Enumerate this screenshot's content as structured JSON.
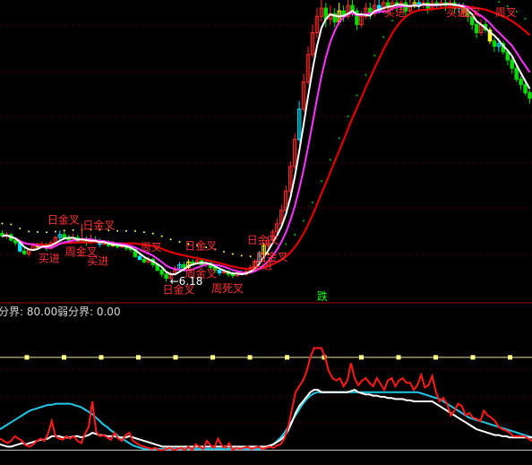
{
  "chart_data": [
    {
      "type": "candlestick",
      "title": "",
      "colors": {
        "up": "#ff2b2b",
        "down": "#00dc00",
        "highlight_up": "#00e5ff",
        "highlight_down": "#ffff00",
        "ma_long": "#e00000",
        "ma_short": "#ffffff",
        "ma_mid": "#ff33ff",
        "dots": "#00c800"
      },
      "lowest_price_label": "←6.18",
      "signals": [
        {
          "text": "日金叉",
          "bar": 13,
          "place": "above"
        },
        {
          "text": "日金叉",
          "bar": 21,
          "place": "above"
        },
        {
          "text": "买进",
          "bar": 11,
          "place": "below"
        },
        {
          "text": "买进",
          "bar": 22,
          "place": "below"
        },
        {
          "text": "周金叉",
          "bar": 17,
          "place": "below"
        },
        {
          "text": "日金叉",
          "bar": 44,
          "place": "above"
        },
        {
          "text": "周叉",
          "bar": 34,
          "place": "above"
        },
        {
          "text": "日金叉",
          "bar": 39,
          "place": "below"
        },
        {
          "text": "周金叉",
          "bar": 44,
          "place": "below"
        },
        {
          "text": "周死叉",
          "bar": 50,
          "place": "below"
        },
        {
          "text": "买进",
          "bar": 59,
          "place": "below"
        },
        {
          "text": "日金叉",
          "bar": 58,
          "place": "above"
        },
        {
          "text": "周金叉",
          "bar": 60,
          "place": "below"
        },
        {
          "text": "买进",
          "bar": 89,
          "place": "top"
        },
        {
          "text": "买进",
          "bar": 103,
          "place": "top"
        },
        {
          "text": "周叉",
          "bar": 106,
          "place": "top"
        },
        {
          "text": "周叉",
          "bar": 114,
          "place": "top"
        }
      ],
      "candles": [
        [
          7.95,
          7.85,
          8.05,
          7.8
        ],
        [
          7.85,
          7.9,
          8.0,
          7.75
        ],
        [
          7.9,
          7.7,
          7.95,
          7.65
        ],
        [
          7.7,
          7.6,
          7.8,
          7.5
        ],
        [
          7.6,
          7.3,
          7.65,
          7.25
        ],
        [
          7.3,
          7.2,
          7.4,
          7.15
        ],
        [
          7.2,
          7.35,
          7.4,
          7.1
        ],
        [
          7.35,
          7.5,
          7.6,
          7.3
        ],
        [
          7.5,
          7.45,
          7.6,
          7.35
        ],
        [
          7.45,
          7.55,
          7.65,
          7.4
        ],
        [
          7.55,
          7.4,
          7.6,
          7.3
        ],
        [
          7.4,
          7.6,
          7.7,
          7.35
        ],
        [
          7.6,
          7.8,
          7.85,
          7.55
        ],
        [
          7.8,
          7.9,
          8.05,
          7.7
        ],
        [
          7.9,
          7.75,
          8.0,
          7.7
        ],
        [
          7.75,
          7.7,
          7.9,
          7.6
        ],
        [
          7.7,
          7.8,
          7.95,
          7.65
        ],
        [
          7.8,
          7.65,
          7.9,
          7.6
        ],
        [
          7.65,
          7.75,
          8.3,
          7.6
        ],
        [
          7.75,
          7.6,
          7.85,
          7.5
        ],
        [
          7.6,
          7.7,
          7.9,
          7.55
        ],
        [
          7.7,
          7.65,
          7.85,
          7.6
        ],
        [
          7.65,
          7.55,
          7.75,
          7.45
        ],
        [
          7.55,
          7.6,
          7.7,
          7.5
        ],
        [
          7.6,
          7.5,
          7.7,
          7.45
        ],
        [
          7.5,
          7.55,
          7.65,
          7.45
        ],
        [
          7.55,
          7.45,
          7.6,
          7.4
        ],
        [
          7.45,
          7.5,
          7.6,
          7.4
        ],
        [
          7.5,
          7.4,
          7.55,
          7.3
        ],
        [
          7.4,
          7.35,
          7.5,
          7.25
        ],
        [
          7.35,
          7.1,
          7.4,
          7.05
        ],
        [
          7.1,
          7.0,
          7.2,
          6.95
        ],
        [
          7.0,
          6.9,
          7.05,
          6.85
        ],
        [
          6.9,
          7.0,
          7.1,
          6.85
        ],
        [
          7.0,
          6.8,
          7.05,
          6.7
        ],
        [
          6.8,
          6.6,
          6.85,
          6.55
        ],
        [
          6.6,
          6.45,
          6.7,
          6.35
        ],
        [
          6.45,
          6.3,
          6.5,
          6.18
        ],
        [
          6.3,
          6.45,
          6.55,
          6.25
        ],
        [
          6.45,
          6.6,
          6.75,
          6.4
        ],
        [
          6.6,
          6.8,
          6.9,
          6.55
        ],
        [
          6.8,
          6.7,
          6.9,
          6.6
        ],
        [
          6.7,
          6.9,
          7.0,
          6.65
        ],
        [
          6.9,
          6.85,
          7.0,
          6.75
        ],
        [
          6.85,
          6.95,
          7.1,
          6.8
        ],
        [
          6.95,
          6.8,
          7.05,
          6.7
        ],
        [
          6.8,
          6.85,
          6.95,
          6.7
        ],
        [
          6.85,
          6.7,
          6.9,
          6.6
        ],
        [
          6.7,
          6.6,
          6.8,
          6.5
        ],
        [
          6.6,
          6.5,
          6.7,
          6.4
        ],
        [
          6.5,
          6.55,
          6.65,
          6.45
        ],
        [
          6.55,
          6.45,
          6.6,
          6.35
        ],
        [
          6.45,
          6.4,
          6.55,
          6.3
        ],
        [
          6.4,
          6.5,
          6.6,
          6.35
        ],
        [
          6.5,
          6.45,
          6.6,
          6.4
        ],
        [
          6.45,
          6.55,
          6.65,
          6.4
        ],
        [
          6.55,
          6.7,
          6.8,
          6.5
        ],
        [
          6.7,
          6.9,
          7.0,
          6.65
        ],
        [
          6.9,
          7.2,
          7.3,
          6.85
        ],
        [
          7.2,
          7.5,
          7.6,
          7.1
        ],
        [
          7.5,
          7.7,
          7.85,
          7.4
        ],
        [
          7.7,
          8.0,
          8.1,
          7.6
        ],
        [
          8.0,
          8.3,
          8.5,
          7.9
        ],
        [
          8.3,
          8.8,
          9.0,
          8.2
        ],
        [
          8.8,
          9.5,
          9.7,
          8.7
        ],
        [
          9.5,
          10.4,
          10.6,
          9.4
        ],
        [
          10.4,
          11.4,
          11.6,
          10.3
        ],
        [
          11.4,
          12.5,
          12.8,
          11.3
        ],
        [
          12.5,
          13.5,
          13.8,
          12.4
        ],
        [
          13.5,
          14.5,
          14.8,
          13.4
        ],
        [
          14.5,
          15.3,
          15.6,
          14.4
        ],
        [
          15.3,
          15.9,
          16.2,
          15.1
        ],
        [
          15.9,
          16.2,
          16.5,
          15.7
        ],
        [
          16.2,
          15.8,
          16.4,
          15.5
        ],
        [
          15.8,
          16.0,
          16.3,
          15.6
        ],
        [
          16.0,
          15.7,
          16.2,
          15.5
        ],
        [
          15.7,
          16.1,
          16.4,
          15.6
        ],
        [
          16.1,
          15.9,
          16.3,
          15.7
        ],
        [
          15.9,
          16.3,
          16.5,
          15.8
        ],
        [
          16.3,
          16.1,
          16.5,
          15.9
        ],
        [
          16.1,
          15.6,
          16.2,
          15.4
        ],
        [
          15.6,
          15.9,
          16.1,
          15.5
        ],
        [
          15.9,
          16.2,
          16.4,
          15.8
        ],
        [
          16.2,
          16.0,
          16.4,
          15.8
        ],
        [
          16.0,
          16.3,
          16.5,
          15.9
        ],
        [
          16.3,
          16.1,
          16.5,
          16.0
        ],
        [
          16.1,
          16.4,
          16.5,
          16.0
        ],
        [
          16.4,
          16.2,
          16.5,
          16.0
        ],
        [
          16.2,
          16.4,
          16.5,
          16.1
        ],
        [
          16.4,
          16.3,
          16.5,
          16.1
        ],
        [
          16.3,
          16.4,
          16.5,
          16.2
        ],
        [
          16.4,
          16.1,
          16.5,
          15.9
        ],
        [
          16.1,
          16.3,
          16.5,
          16.0
        ],
        [
          16.3,
          16.4,
          16.5,
          16.2
        ],
        [
          16.4,
          16.3,
          16.5,
          16.1
        ],
        [
          16.3,
          16.4,
          16.5,
          16.2
        ],
        [
          16.4,
          16.2,
          16.5,
          16.0
        ],
        [
          16.2,
          16.4,
          16.5,
          16.1
        ],
        [
          16.4,
          16.3,
          16.5,
          16.2
        ],
        [
          16.3,
          16.4,
          16.5,
          16.2
        ],
        [
          16.4,
          16.3,
          16.5,
          16.1
        ],
        [
          16.3,
          16.4,
          16.5,
          16.2
        ],
        [
          16.4,
          16.2,
          16.5,
          16.0
        ],
        [
          16.2,
          16.3,
          16.4,
          16.0
        ],
        [
          16.3,
          16.1,
          16.4,
          15.9
        ],
        [
          16.1,
          15.9,
          16.2,
          15.7
        ],
        [
          15.9,
          15.6,
          16.0,
          15.4
        ],
        [
          15.6,
          15.3,
          15.7,
          15.1
        ],
        [
          15.3,
          15.6,
          15.8,
          15.2
        ],
        [
          15.6,
          15.4,
          15.8,
          15.3
        ],
        [
          15.4,
          15.0,
          15.5,
          14.9
        ],
        [
          15.0,
          14.8,
          15.1,
          14.6
        ],
        [
          14.8,
          14.9,
          15.1,
          14.6
        ],
        [
          14.9,
          14.6,
          15.0,
          14.5
        ],
        [
          14.6,
          14.3,
          14.7,
          14.1
        ],
        [
          14.3,
          14.0,
          14.4,
          13.8
        ],
        [
          14.0,
          13.6,
          14.1,
          13.5
        ],
        [
          13.6,
          13.4,
          13.7,
          13.2
        ],
        [
          13.4,
          13.1,
          13.5,
          13.0
        ],
        [
          13.1,
          12.9,
          13.2,
          12.7
        ]
      ],
      "ylim": [
        5.6,
        16.5
      ]
    },
    {
      "type": "line",
      "header": {
        "label_a": "分界: 80.00",
        "label_b": "弱分界: 0.00"
      },
      "signal_text": "跌",
      "threshold_values": [
        80,
        0
      ],
      "ylim": [
        -2,
        110
      ],
      "series": [
        {
          "color": "#ff1a1a",
          "values": [
            10,
            8,
            6,
            8,
            12,
            10,
            8,
            4,
            3,
            5,
            8,
            10,
            8,
            14,
            25,
            12,
            10,
            9,
            12,
            10,
            12,
            8,
            6,
            14,
            20,
            42,
            16,
            12,
            13,
            11,
            9,
            15,
            10,
            8,
            13,
            15,
            8,
            6,
            4,
            3,
            2,
            1,
            2,
            0,
            0,
            1,
            2,
            0,
            1,
            2,
            0,
            3,
            0,
            5,
            3,
            1,
            8,
            4,
            2,
            10,
            4,
            2,
            6,
            0,
            2,
            1,
            2,
            3,
            1,
            2,
            3,
            1,
            2,
            3,
            2,
            4,
            5,
            10,
            20,
            35,
            50,
            55,
            60,
            68,
            80,
            88,
            88,
            88,
            80,
            68,
            62,
            60,
            62,
            55,
            60,
            75,
            62,
            56,
            60,
            62,
            58,
            55,
            62,
            57,
            52,
            60,
            62,
            55,
            60,
            62,
            58,
            58,
            52,
            56,
            65,
            54,
            56,
            64,
            50,
            42,
            45,
            40,
            30,
            34,
            40,
            38,
            30,
            32,
            28,
            27,
            25,
            34,
            30,
            28,
            25,
            20,
            18,
            17,
            15,
            12,
            12,
            12,
            12,
            10,
            8
          ]
        },
        {
          "color": "#ffffff",
          "values": [
            5,
            4,
            3,
            3,
            4,
            5,
            6,
            5,
            6,
            7,
            8,
            9,
            9,
            10,
            12,
            12,
            12,
            11,
            11,
            11,
            12,
            12,
            11,
            12,
            13,
            15,
            14,
            13,
            13,
            12,
            12,
            12,
            11,
            11,
            11,
            12,
            11,
            10,
            9,
            8,
            7,
            6,
            5,
            4,
            3,
            3,
            3,
            3,
            3,
            3,
            3,
            3,
            3,
            3,
            3,
            3,
            3,
            3,
            3,
            3,
            3,
            3,
            3,
            3,
            3,
            3,
            3,
            3,
            3,
            3,
            3,
            3,
            3,
            4,
            5,
            7,
            9,
            12,
            17,
            24,
            32,
            38,
            42,
            46,
            50,
            52,
            52,
            50,
            50,
            50,
            50,
            50,
            50,
            50,
            50,
            51,
            52,
            50,
            49,
            48,
            48,
            47,
            47,
            46,
            46,
            45,
            45,
            44,
            44,
            44,
            43,
            43,
            42,
            42,
            42,
            42,
            42,
            42,
            40,
            38,
            36,
            34,
            32,
            30,
            28,
            26,
            24,
            22,
            20,
            18,
            17,
            16,
            15,
            14,
            13,
            13,
            12,
            12,
            11,
            11,
            11,
            11,
            11,
            11,
            11
          ]
        },
        {
          "color": "#1ec8e6",
          "values": [
            18,
            20,
            22,
            24,
            26,
            28,
            30,
            32,
            34,
            35,
            36,
            37,
            38,
            39,
            39,
            40,
            40,
            40,
            40,
            40,
            39,
            38,
            37,
            35,
            33,
            31,
            28,
            25,
            22,
            20,
            17,
            15,
            12,
            10,
            8,
            6,
            4,
            3,
            2,
            1,
            1,
            1,
            1,
            1,
            1,
            1,
            1,
            1,
            1,
            1,
            1,
            1,
            1,
            1,
            1,
            1,
            1,
            1,
            1,
            1,
            1,
            1,
            1,
            1,
            1,
            1,
            1,
            1,
            1,
            1,
            1,
            1,
            2,
            3,
            5,
            8,
            11,
            15,
            20,
            25,
            30,
            35,
            40,
            44,
            47,
            49,
            50,
            50,
            50,
            50,
            50,
            50,
            50,
            50,
            50,
            50,
            50,
            50,
            50,
            50,
            50,
            50,
            50,
            50,
            50,
            50,
            50,
            50,
            50,
            50,
            50,
            50,
            50,
            50,
            49,
            48,
            47,
            46,
            45,
            44,
            42,
            40,
            38,
            36,
            34,
            32,
            30,
            28,
            27,
            26,
            25,
            24,
            23,
            22,
            21,
            20,
            19,
            18,
            17,
            16,
            15,
            14,
            13,
            12,
            11
          ]
        }
      ]
    }
  ]
}
